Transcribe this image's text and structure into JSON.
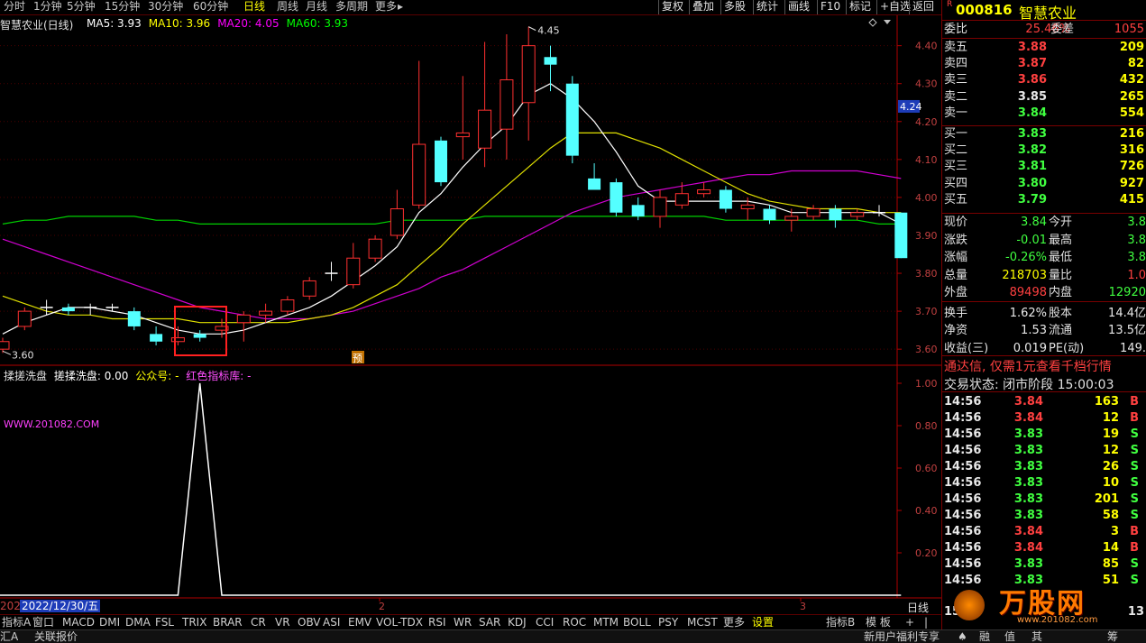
{
  "top_tabs": [
    "分时",
    "1分钟",
    "5分钟",
    "15分钟",
    "30分钟",
    "60分钟",
    "日线",
    "周线",
    "月线",
    "多周期",
    "更多"
  ],
  "active_tab": "日线",
  "top_right_buttons": [
    "复权",
    "叠加",
    "多股",
    "统计",
    "画线",
    "F10",
    "标记",
    "+自选",
    "返回"
  ],
  "chart": {
    "title": "智慧农业(日线)",
    "ma": [
      {
        "label": "MA5: 3.93",
        "color": "#ffffff"
      },
      {
        "label": "MA10: 3.96",
        "color": "#ffff00"
      },
      {
        "label": "MA20: 4.05",
        "color": "#ff00ff"
      },
      {
        "label": "MA60: 3.93",
        "color": "#00ff00"
      }
    ],
    "price_ticks": [
      "4.40",
      "4.30",
      "4.20",
      "4.10",
      "4.00",
      "3.90",
      "3.80",
      "3.70",
      "3.60"
    ],
    "current_price_tag": "4.24",
    "high_label": "4.45",
    "low_label": "3.60",
    "pre_label": "预"
  },
  "indicator": {
    "name1": "揉搓洗盘",
    "name2": "搓揉洗盘: 0.00",
    "name3": "公众号: -",
    "name4": "红色指标库: -",
    "watermark": "WWW.201082.COM",
    "ticks": [
      "1.00",
      "0.80",
      "0.60",
      "0.40",
      "0.20"
    ]
  },
  "date_axis": {
    "start_label": "202",
    "date": "2022/12/30/五",
    "marks": [
      "2",
      "3"
    ],
    "period": "日线"
  },
  "bottom_tabs": [
    "指标A",
    "窗口",
    "MACD",
    "DMI",
    "DMA",
    "FSL",
    "TRIX",
    "BRAR",
    "CR",
    "VR",
    "OBV",
    "ASI",
    "EMV",
    "VOL-TDX",
    "RSI",
    "WR",
    "SAR",
    "KDJ",
    "CCI",
    "ROC",
    "MTM",
    "BOLL",
    "PSY",
    "MCST",
    "更多",
    "设置"
  ],
  "bottom_right_tabs": [
    "指标B",
    "模 板",
    "+",
    "|"
  ],
  "status": {
    "left1": "汇A",
    "left2": "关联报价",
    "right1": "新用户福利专享",
    "icons": [
      "♠",
      "融",
      "值",
      "其",
      "筹"
    ]
  },
  "quote": {
    "badge": "R",
    "code": "000816",
    "name": "智慧农业",
    "webi_label": "委比",
    "webi_value": "25.46%",
    "wecha_label": "委差",
    "wecha_value": "1055",
    "asks": [
      {
        "label": "卖五",
        "price": "3.88",
        "vol": "209",
        "pc": "red"
      },
      {
        "label": "卖四",
        "price": "3.87",
        "vol": "82",
        "pc": "red"
      },
      {
        "label": "卖三",
        "price": "3.86",
        "vol": "432",
        "pc": "red"
      },
      {
        "label": "卖二",
        "price": "3.85",
        "vol": "265",
        "pc": "white"
      },
      {
        "label": "卖一",
        "price": "3.84",
        "vol": "554",
        "pc": "green"
      }
    ],
    "bids": [
      {
        "label": "买一",
        "price": "3.83",
        "vol": "216",
        "pc": "green"
      },
      {
        "label": "买二",
        "price": "3.82",
        "vol": "316",
        "pc": "green"
      },
      {
        "label": "买三",
        "price": "3.81",
        "vol": "726",
        "pc": "green"
      },
      {
        "label": "买四",
        "price": "3.80",
        "vol": "927",
        "pc": "green"
      },
      {
        "label": "买五",
        "price": "3.79",
        "vol": "415",
        "pc": "green"
      }
    ],
    "stats": [
      {
        "l1": "现价",
        "v1": "3.84",
        "c1": "green",
        "l2": "今开",
        "v2": "3.8",
        "c2": "green"
      },
      {
        "l1": "涨跌",
        "v1": "-0.01",
        "c1": "green",
        "l2": "最高",
        "v2": "3.8",
        "c2": "green"
      },
      {
        "l1": "涨幅",
        "v1": "-0.26%",
        "c1": "green",
        "l2": "最低",
        "v2": "3.8",
        "c2": "green"
      },
      {
        "l1": "总量",
        "v1": "218703",
        "c1": "yellow",
        "l2": "量比",
        "v2": "1.0",
        "c2": "red"
      },
      {
        "l1": "外盘",
        "v1": "89498",
        "c1": "red",
        "l2": "内盘",
        "v2": "12920",
        "c2": "green"
      },
      {
        "l1": "换手",
        "v1": "1.62%",
        "c1": "white",
        "l2": "股本",
        "v2": "14.4亿",
        "c2": "white"
      },
      {
        "l1": "净资",
        "v1": "1.53",
        "c1": "white",
        "l2": "流通",
        "v2": "13.5亿",
        "c2": "white"
      },
      {
        "l1": "收益(三)",
        "v1": "0.019",
        "c1": "white",
        "l2": "PE(动)",
        "v2": "149.",
        "c2": "white"
      }
    ],
    "ad": "通达信, 仅需1元查看千档行情",
    "trade_state": "交易状态: 闭市阶段 15:00:03",
    "ticks": [
      {
        "t": "14:56",
        "p": "3.84",
        "pc": "red",
        "v": "163",
        "vc": "yellow",
        "s": "B",
        "sc": "red"
      },
      {
        "t": "14:56",
        "p": "3.84",
        "pc": "red",
        "v": "12",
        "vc": "yellow",
        "s": "B",
        "sc": "red"
      },
      {
        "t": "14:56",
        "p": "3.83",
        "pc": "green",
        "v": "19",
        "vc": "yellow",
        "s": "S",
        "sc": "green"
      },
      {
        "t": "14:56",
        "p": "3.83",
        "pc": "green",
        "v": "12",
        "vc": "yellow",
        "s": "S",
        "sc": "green"
      },
      {
        "t": "14:56",
        "p": "3.83",
        "pc": "green",
        "v": "26",
        "vc": "yellow",
        "s": "S",
        "sc": "green"
      },
      {
        "t": "14:56",
        "p": "3.83",
        "pc": "green",
        "v": "10",
        "vc": "yellow",
        "s": "S",
        "sc": "green"
      },
      {
        "t": "14:56",
        "p": "3.83",
        "pc": "green",
        "v": "201",
        "vc": "yellow",
        "s": "S",
        "sc": "green"
      },
      {
        "t": "14:56",
        "p": "3.83",
        "pc": "green",
        "v": "58",
        "vc": "yellow",
        "s": "S",
        "sc": "green"
      },
      {
        "t": "14:56",
        "p": "3.84",
        "pc": "red",
        "v": "3",
        "vc": "yellow",
        "s": "B",
        "sc": "red"
      },
      {
        "t": "14:56",
        "p": "3.84",
        "pc": "red",
        "v": "14",
        "vc": "yellow",
        "s": "B",
        "sc": "red"
      },
      {
        "t": "14:56",
        "p": "3.83",
        "pc": "green",
        "v": "85",
        "vc": "yellow",
        "s": "S",
        "sc": "green"
      },
      {
        "t": "14:56",
        "p": "3.83",
        "pc": "green",
        "v": "51",
        "vc": "yellow",
        "s": "S",
        "sc": "green"
      }
    ],
    "logo_text": "万股网",
    "logo_url": "www.201082.com",
    "last_row_t": "15:",
    "last_row_n": "13"
  },
  "chart_data": {
    "type": "candlestick",
    "price_axis": [
      3.6,
      4.45
    ],
    "candles": [
      {
        "o": 3.6,
        "c": 3.62,
        "h": 3.63,
        "l": 3.59
      },
      {
        "o": 3.66,
        "c": 3.7,
        "h": 3.71,
        "l": 3.65
      },
      {
        "o": 3.71,
        "c": 3.71,
        "h": 3.73,
        "l": 3.69
      },
      {
        "o": 3.71,
        "c": 3.7,
        "h": 3.72,
        "l": 3.69
      },
      {
        "o": 3.71,
        "c": 3.71,
        "h": 3.72,
        "l": 3.69
      },
      {
        "o": 3.71,
        "c": 3.71,
        "h": 3.72,
        "l": 3.7
      },
      {
        "o": 3.7,
        "c": 3.66,
        "h": 3.71,
        "l": 3.65
      },
      {
        "o": 3.64,
        "c": 3.62,
        "h": 3.66,
        "l": 3.61
      },
      {
        "o": 3.62,
        "c": 3.63,
        "h": 3.66,
        "l": 3.61
      },
      {
        "o": 3.64,
        "c": 3.63,
        "h": 3.65,
        "l": 3.62
      },
      {
        "o": 3.65,
        "c": 3.66,
        "h": 3.68,
        "l": 3.63
      },
      {
        "o": 3.67,
        "c": 3.69,
        "h": 3.7,
        "l": 3.62
      },
      {
        "o": 3.69,
        "c": 3.7,
        "h": 3.72,
        "l": 3.67
      },
      {
        "o": 3.7,
        "c": 3.73,
        "h": 3.74,
        "l": 3.69
      },
      {
        "o": 3.74,
        "c": 3.78,
        "h": 3.79,
        "l": 3.73
      },
      {
        "o": 3.8,
        "c": 3.8,
        "h": 3.83,
        "l": 3.78
      },
      {
        "o": 3.77,
        "c": 3.84,
        "h": 3.88,
        "l": 3.76
      },
      {
        "o": 3.84,
        "c": 3.89,
        "h": 3.9,
        "l": 3.83
      },
      {
        "o": 3.9,
        "c": 3.97,
        "h": 4.02,
        "l": 3.89
      },
      {
        "o": 3.98,
        "c": 4.14,
        "h": 4.36,
        "l": 3.97
      },
      {
        "o": 4.15,
        "c": 4.04,
        "h": 4.16,
        "l": 4.03
      },
      {
        "o": 4.16,
        "c": 4.17,
        "h": 4.32,
        "l": 4.1
      },
      {
        "o": 4.13,
        "c": 4.23,
        "h": 4.41,
        "l": 4.08
      },
      {
        "o": 4.18,
        "c": 4.31,
        "h": 4.43,
        "l": 4.1
      },
      {
        "o": 4.25,
        "c": 4.4,
        "h": 4.45,
        "l": 4.15
      },
      {
        "o": 4.37,
        "c": 4.35,
        "h": 4.4,
        "l": 4.28
      },
      {
        "o": 4.3,
        "c": 4.11,
        "h": 4.32,
        "l": 4.09
      },
      {
        "o": 4.05,
        "c": 4.02,
        "h": 4.09,
        "l": 4.02
      },
      {
        "o": 4.04,
        "c": 3.96,
        "h": 4.05,
        "l": 3.95
      },
      {
        "o": 3.98,
        "c": 3.95,
        "h": 4.0,
        "l": 3.94
      },
      {
        "o": 3.95,
        "c": 4.0,
        "h": 4.02,
        "l": 3.92
      },
      {
        "o": 3.98,
        "c": 4.01,
        "h": 4.04,
        "l": 3.97
      },
      {
        "o": 4.01,
        "c": 4.02,
        "h": 4.04,
        "l": 4.0
      },
      {
        "o": 4.02,
        "c": 3.97,
        "h": 4.03,
        "l": 3.96
      },
      {
        "o": 3.97,
        "c": 3.98,
        "h": 4.0,
        "l": 3.94
      },
      {
        "o": 3.97,
        "c": 3.94,
        "h": 3.98,
        "l": 3.93
      },
      {
        "o": 3.94,
        "c": 3.95,
        "h": 3.97,
        "l": 3.91
      },
      {
        "o": 3.95,
        "c": 3.97,
        "h": 3.98,
        "l": 3.94
      },
      {
        "o": 3.97,
        "c": 3.94,
        "h": 3.98,
        "l": 3.92
      },
      {
        "o": 3.95,
        "c": 3.96,
        "h": 3.97,
        "l": 3.94
      },
      {
        "o": 3.96,
        "c": 3.96,
        "h": 3.98,
        "l": 3.95
      },
      {
        "o": 3.96,
        "c": 3.84,
        "h": 3.96,
        "l": 3.84
      }
    ],
    "ma5": [
      3.64,
      3.67,
      3.69,
      3.71,
      3.71,
      3.7,
      3.69,
      3.67,
      3.65,
      3.64,
      3.64,
      3.65,
      3.67,
      3.69,
      3.71,
      3.74,
      3.78,
      3.82,
      3.87,
      3.96,
      4.01,
      4.08,
      4.14,
      4.19,
      4.27,
      4.3,
      4.26,
      4.2,
      4.12,
      4.03,
      3.99,
      3.99,
      3.99,
      3.99,
      3.99,
      3.98,
      3.96,
      3.96,
      3.96,
      3.96,
      3.96,
      3.93
    ],
    "ma10": [
      3.74,
      3.72,
      3.7,
      3.69,
      3.69,
      3.68,
      3.68,
      3.68,
      3.68,
      3.67,
      3.67,
      3.67,
      3.67,
      3.67,
      3.68,
      3.69,
      3.71,
      3.74,
      3.77,
      3.82,
      3.87,
      3.93,
      3.98,
      4.03,
      4.08,
      4.13,
      4.17,
      4.17,
      4.17,
      4.15,
      4.13,
      4.1,
      4.07,
      4.04,
      4.01,
      3.99,
      3.98,
      3.97,
      3.97,
      3.97,
      3.96,
      3.96
    ],
    "ma20": [
      3.89,
      3.87,
      3.85,
      3.83,
      3.81,
      3.79,
      3.77,
      3.75,
      3.73,
      3.71,
      3.7,
      3.69,
      3.68,
      3.68,
      3.68,
      3.69,
      3.7,
      3.72,
      3.74,
      3.76,
      3.79,
      3.81,
      3.84,
      3.87,
      3.9,
      3.93,
      3.96,
      3.98,
      4.0,
      4.01,
      4.02,
      4.03,
      4.04,
      4.05,
      4.06,
      4.06,
      4.07,
      4.07,
      4.07,
      4.07,
      4.06,
      4.05
    ],
    "ma60": [
      3.93,
      3.94,
      3.94,
      3.95,
      3.95,
      3.95,
      3.95,
      3.94,
      3.94,
      3.93,
      3.93,
      3.93,
      3.93,
      3.93,
      3.93,
      3.93,
      3.93,
      3.93,
      3.94,
      3.94,
      3.94,
      3.94,
      3.95,
      3.95,
      3.95,
      3.95,
      3.95,
      3.95,
      3.95,
      3.95,
      3.95,
      3.95,
      3.95,
      3.94,
      3.94,
      3.94,
      3.94,
      3.94,
      3.94,
      3.94,
      3.93,
      3.93
    ],
    "indicator_values": [
      0,
      0,
      0,
      0,
      0,
      0,
      0,
      0,
      0,
      1,
      0,
      0,
      0,
      0,
      0,
      0,
      0,
      0,
      0,
      0,
      0,
      0,
      0,
      0,
      0,
      0,
      0,
      0,
      0,
      0,
      0,
      0,
      0,
      0,
      0,
      0,
      0,
      0,
      0,
      0,
      0,
      0
    ],
    "indicator_range": [
      0,
      1
    ]
  }
}
